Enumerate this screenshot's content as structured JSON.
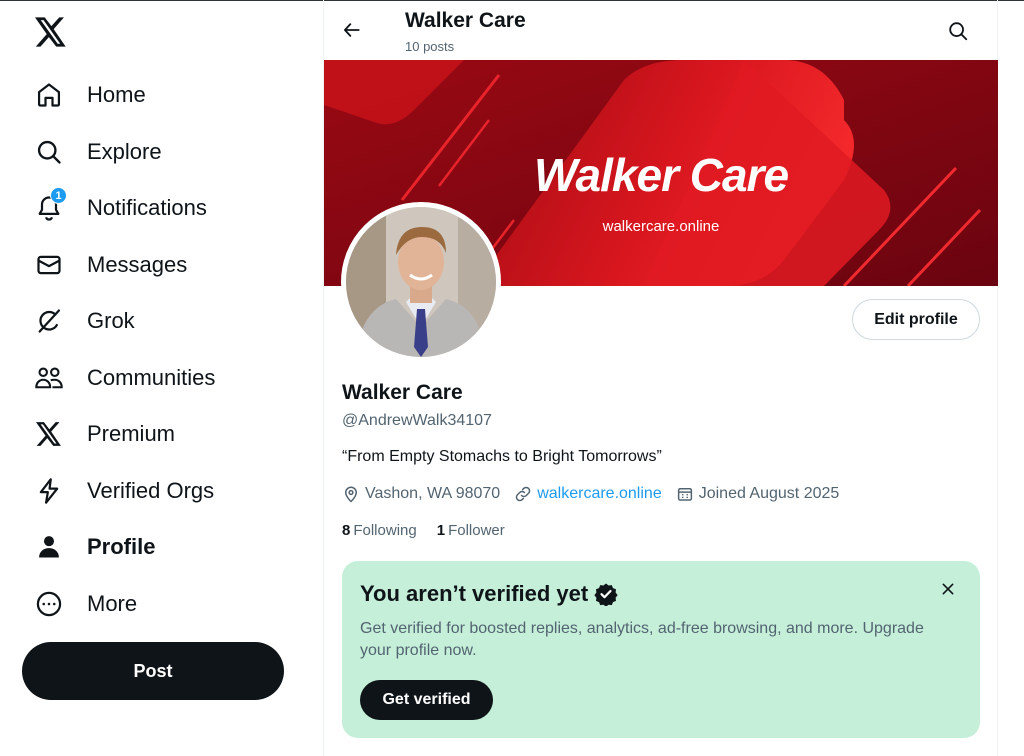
{
  "sidebar": {
    "logo": "x-logo-icon",
    "items": [
      {
        "label": "Home",
        "icon": "home-icon"
      },
      {
        "label": "Explore",
        "icon": "search-icon"
      },
      {
        "label": "Notifications",
        "icon": "bell-icon",
        "badge": "1"
      },
      {
        "label": "Messages",
        "icon": "envelope-icon"
      },
      {
        "label": "Grok",
        "icon": "grok-icon"
      },
      {
        "label": "Communities",
        "icon": "communities-icon"
      },
      {
        "label": "Premium",
        "icon": "x-logo-icon"
      },
      {
        "label": "Verified Orgs",
        "icon": "lightning-icon"
      },
      {
        "label": "Profile",
        "icon": "person-icon",
        "active": true
      },
      {
        "label": "More",
        "icon": "more-circle-icon"
      }
    ],
    "post_label": "Post"
  },
  "header": {
    "title": "Walker Care",
    "subtitle": "10 posts"
  },
  "banner": {
    "title": "Walker Care",
    "url": "walkercare.online"
  },
  "profile": {
    "edit_label": "Edit profile",
    "name": "Walker Care",
    "handle": "@AndrewWalk34107",
    "bio": "“From Empty Stomachs to Bright Tomorrows”",
    "location": "Vashon, WA 98070",
    "website": "walkercare.online",
    "joined": "Joined August 2025",
    "following_count": "8",
    "following_label": "Following",
    "followers_count": "1",
    "followers_label": "Follower"
  },
  "verify_card": {
    "title": "You aren’t verified yet",
    "description": "Get verified for boosted replies, analytics, ad-free browsing, and more. Upgrade your profile now.",
    "button_label": "Get verified"
  },
  "colors": {
    "accent": "#1d9bf0",
    "text": "#0f1419",
    "muted": "#536471",
    "verify_bg": "#c5efd9",
    "banner_red": "#e01a22"
  }
}
